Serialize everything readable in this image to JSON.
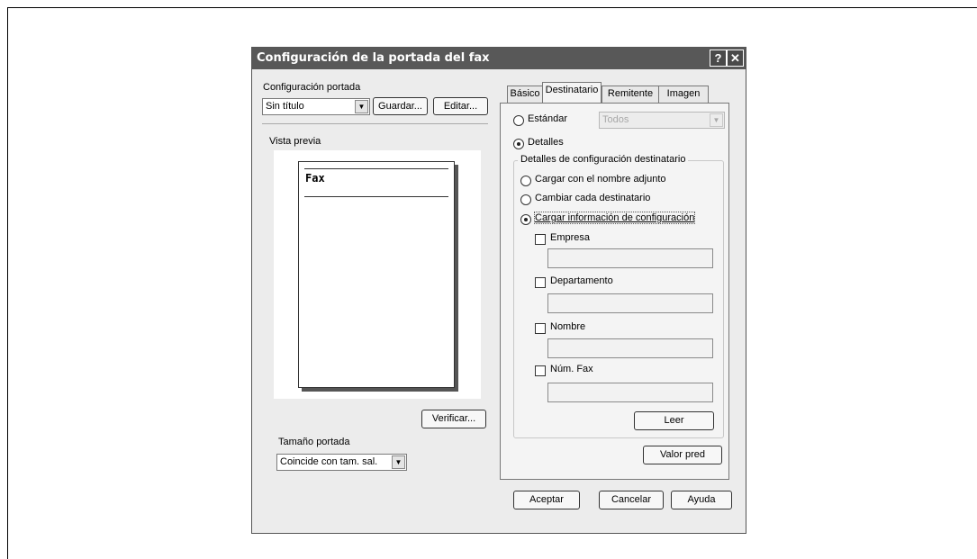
{
  "dialog": {
    "title": "Configuración de la portada del fax",
    "help_btn": "?",
    "close_btn": "✕"
  },
  "left": {
    "config_label": "Configuración portada",
    "config_value": "Sin título",
    "guardar": "Guardar...",
    "editar": "Editar...",
    "preview_label": "Vista previa",
    "preview_text": "Fax",
    "verificar": "Verificar...",
    "size_label": "Tamaño portada",
    "size_value": "Coincide con tam. sal."
  },
  "tabs": [
    "Básico",
    "Destinatario",
    "Remitente",
    "Imagen"
  ],
  "right": {
    "estandar": "Estándar",
    "estandar_select": "Todos",
    "detalles": "Detalles",
    "group_title": "Detalles de configuración destinatario",
    "opt_cargar_nombre": "Cargar con el nombre adjunto",
    "opt_cambiar": "Cambiar cada destinatario",
    "opt_cargar_info": "Cargar información de configuración",
    "empresa": "Empresa",
    "departamento": "Departamento",
    "nombre": "Nombre",
    "num_fax": "Núm. Fax",
    "leer": "Leer",
    "valor_pred": "Valor pred"
  },
  "footer": {
    "aceptar": "Aceptar",
    "cancelar": "Cancelar",
    "ayuda": "Ayuda"
  }
}
